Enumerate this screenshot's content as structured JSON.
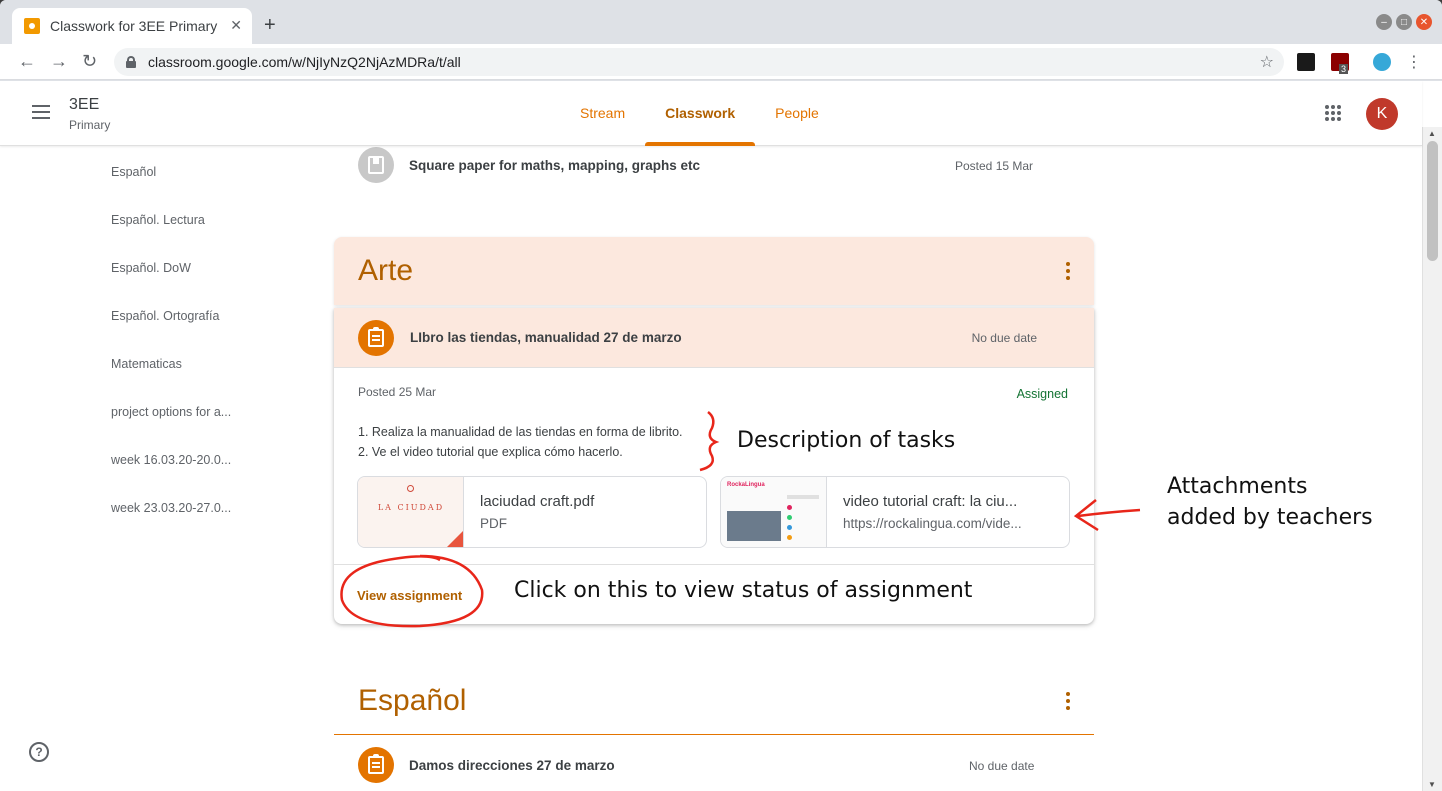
{
  "browser": {
    "tab_title": "Classwork for 3EE Primary",
    "url": "classroom.google.com/w/NjIyNzQ2NjAzMDRa/t/all",
    "extension_badge": "3"
  },
  "app": {
    "class_name": "3EE",
    "class_section": "Primary",
    "tabs": [
      {
        "label": "Stream"
      },
      {
        "label": "Classwork"
      },
      {
        "label": "People"
      }
    ],
    "avatar_letter": "K",
    "accent_color": "#e37400"
  },
  "sidebar": {
    "items": [
      {
        "label": "Español"
      },
      {
        "label": "Español. Lectura"
      },
      {
        "label": "Español. DoW"
      },
      {
        "label": "Español. Ortografía"
      },
      {
        "label": "Matematicas"
      },
      {
        "label": "project options for a..."
      },
      {
        "label": "week 16.03.20-20.0..."
      },
      {
        "label": "week 23.03.20-27.0..."
      }
    ]
  },
  "top_item": {
    "title": "Square paper for maths, mapping, graphs etc",
    "date": "Posted 15 Mar",
    "icon": "material-icon"
  },
  "topics": [
    {
      "title": "Arte",
      "assignment": {
        "title": "LIbro las tiendas, manualidad 27 de marzo",
        "due": "No due date",
        "posted": "Posted 25 Mar",
        "status": "Assigned",
        "description": [
          "1. Realiza la manualidad de las tiendas en forma de librito.",
          "2. Ve el video tutorial que explica cómo hacerlo."
        ],
        "attachments": [
          {
            "name": "laciudad craft.pdf",
            "sub": "PDF",
            "thumb_text": "LA CIUDAD"
          },
          {
            "name": "video tutorial craft: la ciu...",
            "sub": "https://rockalingua.com/vide...",
            "thumb_text": "RockaLingua"
          }
        ],
        "action": "View assignment"
      }
    },
    {
      "title": "Español",
      "first_item": {
        "title": "Damos direcciones 27 de marzo",
        "due": "No due date"
      }
    }
  ],
  "annotations": {
    "description": "Description of tasks",
    "attachments_line1": "Attachments",
    "attachments_line2": "added by teachers",
    "view_status": "Click on this to view status of assignment",
    "color": "#e8261a"
  }
}
